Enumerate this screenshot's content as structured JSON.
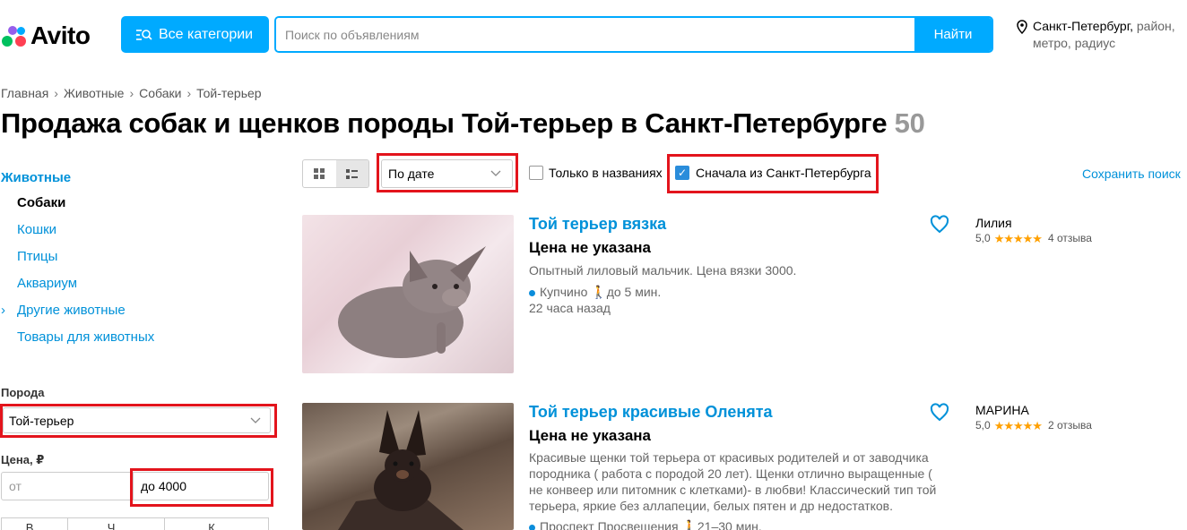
{
  "header": {
    "logo_text": "Avito",
    "categories_label": "Все категории",
    "search_placeholder": "Поиск по объявлениям",
    "search_button": "Найти",
    "location_city": "Санкт-Петербург,",
    "location_rest_1": "район,",
    "location_rest_2": "метро, радиус"
  },
  "breadcrumb": [
    "Главная",
    "Животные",
    "Собаки",
    "Той-терьер"
  ],
  "page_title": "Продажа собак и щенков породы Той-терьер в Санкт-Петербурге",
  "result_count": "50",
  "sidebar": {
    "root": "Животные",
    "items": [
      {
        "label": "Собаки",
        "active": true
      },
      {
        "label": "Кошки"
      },
      {
        "label": "Птицы"
      },
      {
        "label": "Аквариум"
      },
      {
        "label": "Другие животные",
        "arrow": "›"
      },
      {
        "label": "Товары для животных"
      }
    ],
    "breed_label": "Порода",
    "breed_value": "Той-терьер",
    "price_label": "Цена, ₽",
    "price_from_placeholder": "от",
    "price_to_value": "до 4000",
    "segments": [
      "В...",
      "Ч...",
      "К..."
    ]
  },
  "toolbar": {
    "sort_value": "По дате",
    "only_titles_label": "Только в названиях",
    "spb_first_label": "Сначала из Санкт-Петербурга",
    "save_search": "Сохранить поиск"
  },
  "listings": [
    {
      "title": "Той терьер вязка",
      "price": "Цена не указана",
      "description": "Опытный лиловый мальчик. Цена вязки 3000.",
      "location": "Купчино",
      "walk": "до 5 мин.",
      "time": "22 часа назад",
      "seller": "Лилия",
      "rating": "5,0",
      "stars": "★★★★★",
      "reviews": "4 отзыва"
    },
    {
      "title": "Той терьер красивые Оленята",
      "price": "Цена не указана",
      "description": "Красивые щенки той терьера от красивых родителей и от заводчика породника ( работа с породой 20 лет). Щенки отлично выращенные ( не конвеер или питомник с клетками)- в любви! Классический тип той терьера, яркие без аллапеции, белых пятен и др недостатков. Ровны…",
      "location": "Проспект Просвещения",
      "walk": "21–30 мин.",
      "seller": "МАРИНА",
      "rating": "5,0",
      "stars": "★★★★★",
      "reviews": "2 отзыва"
    }
  ],
  "colors": {
    "accent": "#00aaff",
    "link": "#0091d9",
    "highlight": "#e3141c",
    "star": "#ffa000"
  }
}
